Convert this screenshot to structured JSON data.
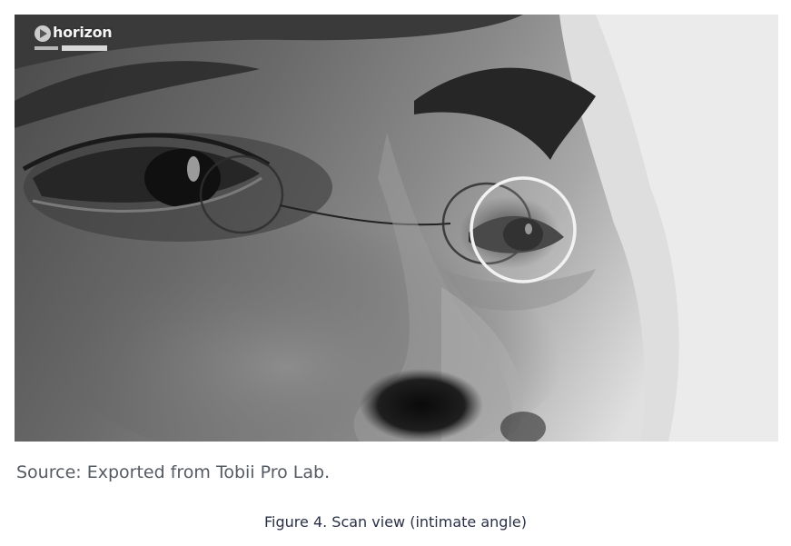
{
  "figure": {
    "image_logo_text": "horizon",
    "gaze_marker_color": "#f2f2f2",
    "source_text": "Source: Exported from Tobii Pro Lab.",
    "caption_text": "Figure 4. Scan view (intimate angle)"
  }
}
